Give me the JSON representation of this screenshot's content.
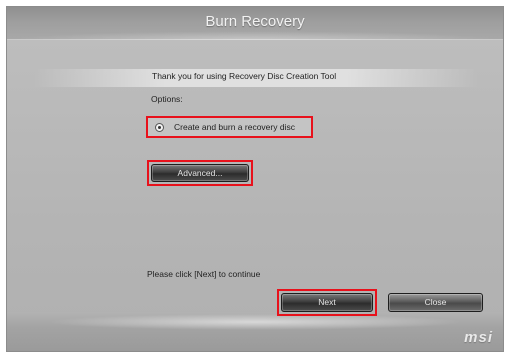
{
  "window": {
    "title": "Burn Recovery"
  },
  "content": {
    "heading": "Thank you for using Recovery Disc Creation Tool",
    "options_label": "Options:",
    "radio_option": {
      "label": "Create and burn a recovery disc",
      "selected": true
    },
    "advanced_label": "Advanced...",
    "instruction": "Please click [Next] to continue"
  },
  "buttons": {
    "next_label": "Next",
    "close_label": "Close"
  },
  "brand": {
    "logo_text": "msi"
  },
  "colors": {
    "highlight_frame": "#e8111b",
    "window_background": "#b8b8b8",
    "button_dark": "#2c2c2c"
  }
}
